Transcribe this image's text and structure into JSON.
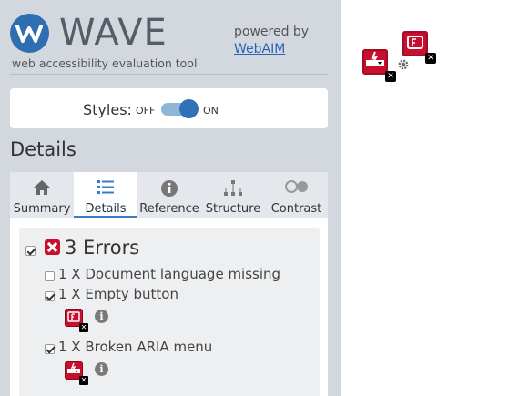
{
  "brand": {
    "logo_text": "WAVE",
    "subtitle": "web accessibility evaluation tool",
    "powered_by": "powered by",
    "webaim_link": "WebAIM"
  },
  "styles_toggle": {
    "label": "Styles:",
    "off_label": "OFF",
    "on_label": "ON",
    "state": "on"
  },
  "section": {
    "title": "Details"
  },
  "tabs": [
    {
      "label": "Summary",
      "icon": "home-icon",
      "active": false
    },
    {
      "label": "Details",
      "icon": "list-icon",
      "active": true
    },
    {
      "label": "Reference",
      "icon": "info-icon",
      "active": false
    },
    {
      "label": "Structure",
      "icon": "sitemap-icon",
      "active": false
    },
    {
      "label": "Contrast",
      "icon": "contrast-icon",
      "active": false
    }
  ],
  "errors": {
    "title": "3 Errors",
    "checked": true,
    "items": [
      {
        "label": "1 X Document language missing",
        "checked": false
      },
      {
        "label": "1 X Empty button",
        "checked": true
      },
      {
        "label": "1 X Broken ARIA menu",
        "checked": true
      }
    ]
  },
  "colors": {
    "sidebar_bg": "#d3d8df",
    "accent": "#3071b8",
    "error": "#c8102e"
  }
}
